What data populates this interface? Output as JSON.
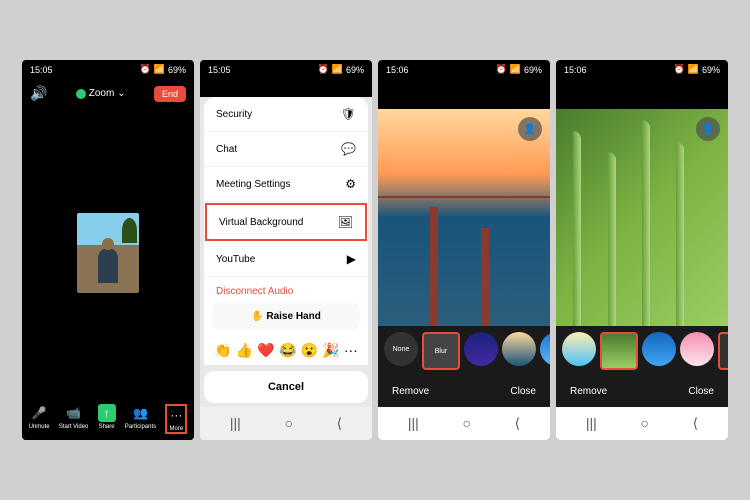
{
  "status": {
    "time1": "15:05",
    "time2": "15:05",
    "time3": "15:06",
    "time4": "15:06",
    "battery": "69%",
    "alarm": "⏰",
    "signal": "📶"
  },
  "screen1": {
    "zoom": "Zoom",
    "zoomArrow": "⌄",
    "end": "End",
    "toolbar": {
      "unmute": "Unmute",
      "video": "Start Video",
      "share": "Share",
      "participants": "Participants",
      "more": "More"
    }
  },
  "screen2": {
    "menu": {
      "security": "Security",
      "chat": "Chat",
      "settings": "Meeting Settings",
      "vbg": "Virtual Background",
      "youtube": "YouTube",
      "disconnect": "Disconnect Audio",
      "raise": "✋ Raise Hand",
      "cancel": "Cancel"
    },
    "emojis": [
      "👏",
      "👍",
      "❤️",
      "😂",
      "😮",
      "🎉",
      "···"
    ]
  },
  "screen3": {
    "chips": {
      "none": "None",
      "blur": "Blur"
    },
    "actions": {
      "remove": "Remove",
      "close": "Close"
    }
  },
  "screen4": {
    "actions": {
      "remove": "Remove",
      "close": "Close"
    }
  },
  "icons": {
    "speaker": "🔊",
    "shield": "🛡",
    "chat": "💬",
    "gear": "⚙",
    "vbg": "🖼",
    "yt": "▶",
    "mic": "🎤",
    "cam": "📹",
    "share": "↑",
    "people": "👥",
    "dots": "···",
    "plus": "+",
    "person": "👤"
  },
  "nav": {
    "recent": "|||",
    "home": "○",
    "back": "⟨"
  }
}
